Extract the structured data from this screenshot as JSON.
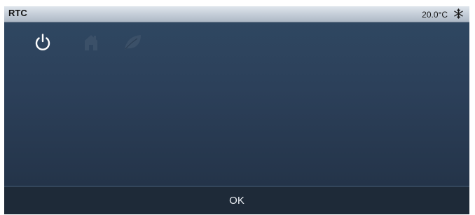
{
  "header": {
    "title": "RTC",
    "temperature": "20.0°C",
    "mode_icon": "snowflake-icon"
  },
  "mode_buttons": [
    {
      "icon": "power-icon",
      "state": "active"
    },
    {
      "icon": "home-icon",
      "state": "inactive"
    },
    {
      "icon": "leaf-icon",
      "state": "inactive"
    }
  ],
  "footer": {
    "ok_label": "OK"
  },
  "colors": {
    "panel_background": "#2a3e56",
    "header_background": "#c3ccd7",
    "footer_background": "#1e2a38",
    "active_icon": "#ffffff",
    "inactive_icon": "#3b5068"
  }
}
